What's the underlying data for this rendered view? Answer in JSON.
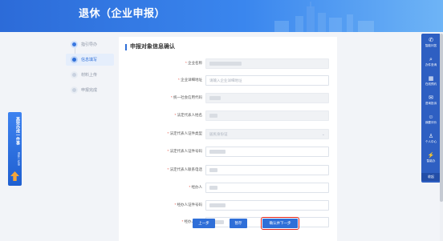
{
  "header": {
    "title": "退休（企业申报）"
  },
  "steps": [
    {
      "label": "指引导办",
      "state": "done"
    },
    {
      "label": "信息填写",
      "state": "active"
    },
    {
      "label": "材料上传",
      "state": "todo"
    },
    {
      "label": "申报完成",
      "state": "todo"
    }
  ],
  "form": {
    "title": "申报对象信息确认",
    "fields": [
      {
        "label": "企业名称",
        "required": true,
        "value": "",
        "placeholder": "",
        "readonly": true
      },
      {
        "label": "企业详细地址",
        "required": true,
        "value": "",
        "placeholder": "请输入企业详细地址",
        "readonly": false
      },
      {
        "label": "统一社会信用代码",
        "required": true,
        "value": "",
        "placeholder": "",
        "readonly": true
      },
      {
        "label": "法定代表人姓名",
        "required": true,
        "value": "",
        "placeholder": "",
        "readonly": true
      },
      {
        "label": "法定代表人证件类型",
        "required": true,
        "value": "居民身份证",
        "placeholder": "",
        "readonly": true,
        "dropdown": true
      },
      {
        "label": "法定代表人证件号码",
        "required": true,
        "value": "",
        "placeholder": "",
        "readonly": false
      },
      {
        "label": "法定代表人联系电话",
        "required": true,
        "value": "",
        "placeholder": "",
        "readonly": false
      },
      {
        "label": "经办人",
        "required": true,
        "value": "",
        "placeholder": "",
        "readonly": false
      },
      {
        "label": "经办人证件号码",
        "required": true,
        "value": "",
        "placeholder": "",
        "readonly": false
      },
      {
        "label": "经办人电话",
        "required": true,
        "value": "",
        "placeholder": "",
        "readonly": false
      }
    ],
    "buttons": {
      "prev": "上一步",
      "save": "暂存",
      "next": "确认并下一步"
    }
  },
  "toolbar": {
    "items": [
      {
        "label": "智能问答",
        "icon": "chat-icon"
      },
      {
        "label": "办件查询",
        "icon": "search-icon"
      },
      {
        "label": "在线预约",
        "icon": "calendar-icon"
      },
      {
        "label": "咨询投诉",
        "icon": "mail-icon"
      },
      {
        "label": "我要评价",
        "icon": "thumbs-up-icon"
      },
      {
        "label": "个人中心",
        "icon": "user-icon"
      },
      {
        "label": "智能办",
        "icon": "bolt-icon"
      }
    ],
    "fold": "收起"
  },
  "ad": {
    "text": "高效办成一件事",
    "sub": "退休一件事"
  },
  "colors": {
    "primary": "#2f6fd8",
    "banner": "#3a86ee",
    "required": "#e54b3c"
  }
}
